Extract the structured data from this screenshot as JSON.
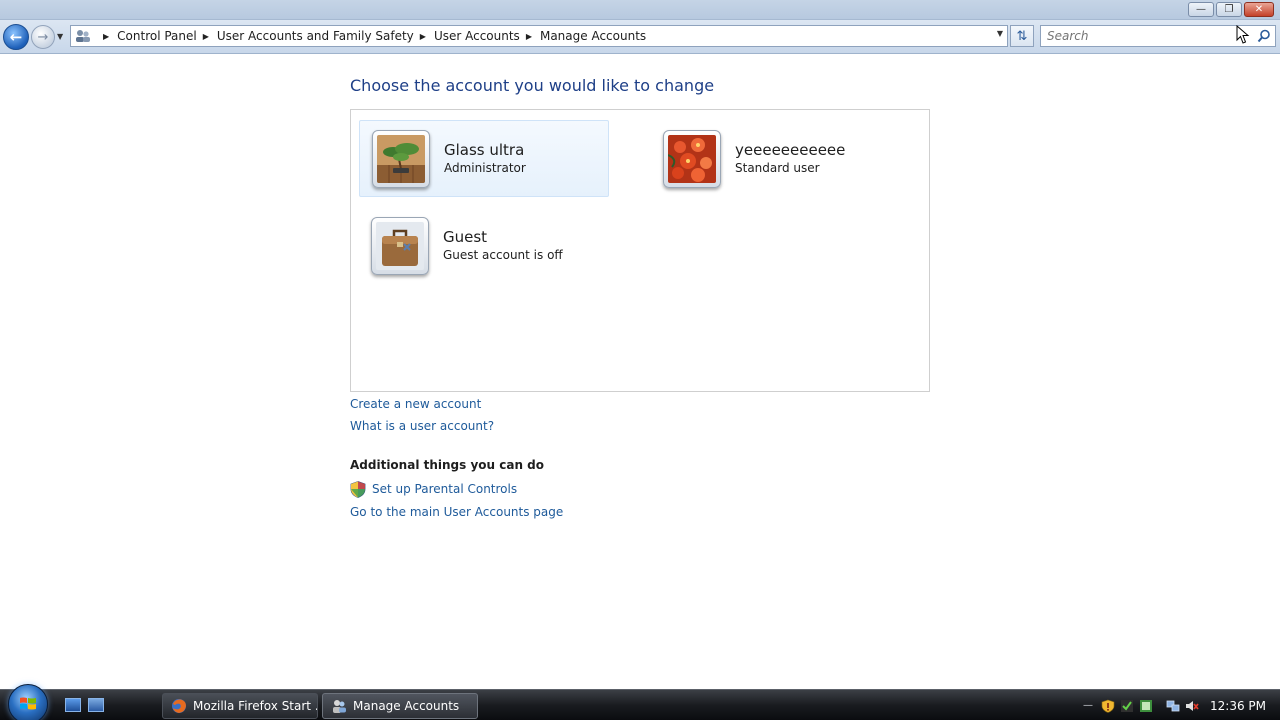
{
  "window": {
    "minimize_icon": "minimize-icon",
    "maximize_icon": "restore-icon",
    "close_icon": "close-icon"
  },
  "navbar": {
    "breadcrumbs": [
      "Control Panel",
      "User Accounts and Family Safety",
      "User Accounts",
      "Manage Accounts"
    ],
    "search_placeholder": "Search"
  },
  "main": {
    "title": "Choose the account you would like to change",
    "accounts": [
      {
        "name": "Glass ultra",
        "type": "Administrator",
        "picture": "bonsai-tree"
      },
      {
        "name": "yeeeeeeeeeee",
        "type": "Standard user",
        "picture": "red-flower"
      },
      {
        "name": "Guest",
        "type": "Guest account is off",
        "picture": "briefcase"
      }
    ],
    "links": {
      "create": "Create a new account",
      "what_is": "What is a user account?"
    },
    "additional_heading": "Additional things you can do",
    "additional_links": {
      "parental": "Set up Parental Controls",
      "main_page": "Go to the main User Accounts page"
    }
  },
  "taskbar": {
    "tasks": [
      {
        "label": "Mozilla Firefox Start ...",
        "icon": "firefox-icon"
      },
      {
        "label": "Manage Accounts",
        "icon": "user-accounts-icon"
      }
    ],
    "clock": "12:36 PM"
  },
  "colors": {
    "link": "#1e5a9a",
    "title": "#1e3f87",
    "selection": "#e6f1fc"
  }
}
